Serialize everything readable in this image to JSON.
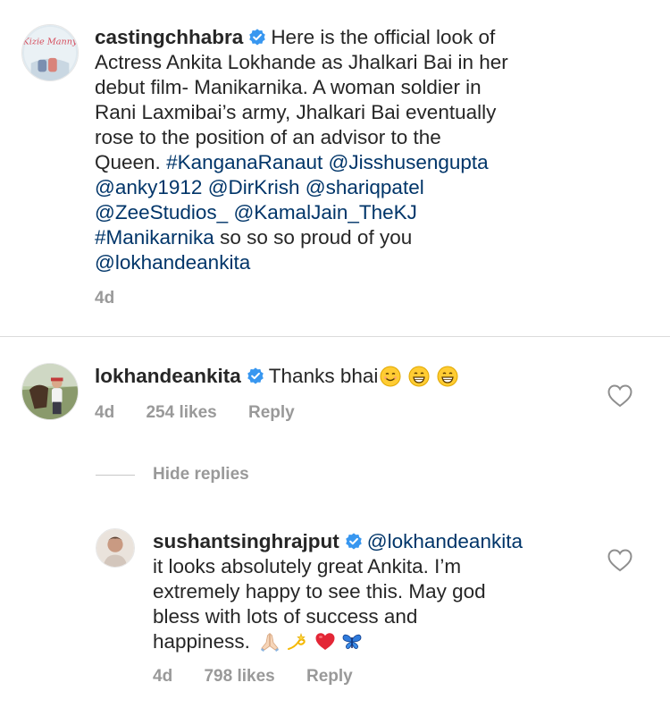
{
  "caption": {
    "username": "castingchhabra",
    "text_lines": [
      "Here is the official look of",
      "Actress Ankita Lokhande as Jhalkari Bai in her",
      "debut film- Manikarnika. A woman soldier in",
      "Rani Laxmibai’s army, Jhalkari Bai eventually",
      "rose to the position of an advisor to the"
    ],
    "line6_text": "Queen.",
    "tag_kangana": "#KanganaRanaut",
    "tag_jisshu": "@Jisshusengupta",
    "tag_anky": "@anky1912",
    "tag_dirkrish": "@DirKrish",
    "tag_shariq": "@shariqpatel",
    "tag_zee": "@ZeeStudios_",
    "tag_kamal": "@KamalJain_TheKJ",
    "tag_manikarnika": "#Manikarnika",
    "tail_text": "so so so proud of you",
    "tag_lokhande": "@lokhandeankita",
    "time": "4d",
    "avatar_logo_text": "Kizie Manny"
  },
  "comment1": {
    "username": "lokhandeankita",
    "text": "Thanks bhai",
    "emojis": [
      "smiling-face-icon",
      "grinning-face-icon",
      "grinning-face-icon"
    ],
    "time": "4d",
    "likes": "254 likes",
    "reply_label": "Reply"
  },
  "hide_replies": "Hide replies",
  "reply1": {
    "username": "sushantsinghrajput",
    "mention": "@lokhandeankita",
    "lines": [
      "it looks absolutely great Ankita. I’m",
      "extremely happy to see this. May god",
      "bless with lots of success and"
    ],
    "last_line": "happiness.",
    "emojis": [
      "folded-hands-icon",
      "dizzy-icon",
      "red-heart-icon",
      "butterfly-icon"
    ],
    "time": "4d",
    "likes": "798 likes",
    "reply_label": "Reply"
  },
  "colors": {
    "text": "#262626",
    "secondary": "#999999",
    "link": "#003569",
    "verified": "#3897f0",
    "divider": "#dbdbdb"
  }
}
